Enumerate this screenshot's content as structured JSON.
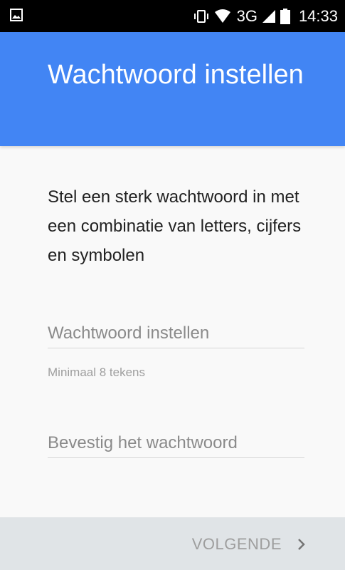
{
  "status_bar": {
    "left_icon": "image-icon",
    "icons": [
      "vibrate-icon",
      "wifi-icon",
      "cell-signal-icon",
      "battery-icon"
    ],
    "network": "3G",
    "time": "14:33"
  },
  "header": {
    "title": "Wachtwoord instellen",
    "background_color": "#4285f4"
  },
  "content": {
    "description": "Stel een sterk wachtwoord in met een combinatie van letters, cijfers en symbolen",
    "password_field": {
      "placeholder": "Wachtwoord instellen",
      "value": ""
    },
    "password_helper": "Minimaal 8 tekens",
    "confirm_field": {
      "placeholder": "Bevestig het wachtwoord",
      "value": ""
    }
  },
  "footer": {
    "next_label": "VOLGENDE",
    "next_icon": "chevron-right-icon"
  }
}
